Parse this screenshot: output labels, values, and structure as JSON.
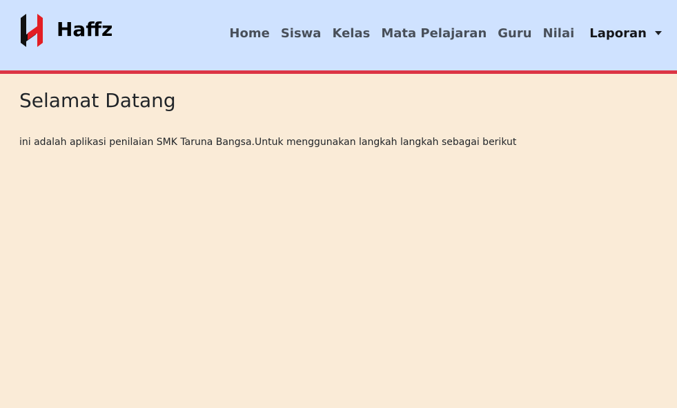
{
  "brand": {
    "name": "Haffz",
    "logo_icon": "haffz-logo-icon"
  },
  "nav": {
    "items": [
      {
        "label": "Home"
      },
      {
        "label": "Siswa"
      },
      {
        "label": "Kelas"
      },
      {
        "label": "Mata Pelajaran"
      },
      {
        "label": "Guru"
      },
      {
        "label": "Nilai"
      }
    ],
    "dropdown": {
      "label": "Laporan",
      "icon": "caret-down-icon"
    }
  },
  "main": {
    "title": "Selamat Datang",
    "intro": "ini adalah aplikasi penilaian SMK Taruna Bangsa.Untuk menggunakan langkah langkah sebagai berikut"
  },
  "colors": {
    "navbar_bg": "#cfe2ff",
    "navbar_border": "#dc3545",
    "page_bg": "#faebd7",
    "logo_red": "#e31e24",
    "logo_black": "#111111"
  }
}
